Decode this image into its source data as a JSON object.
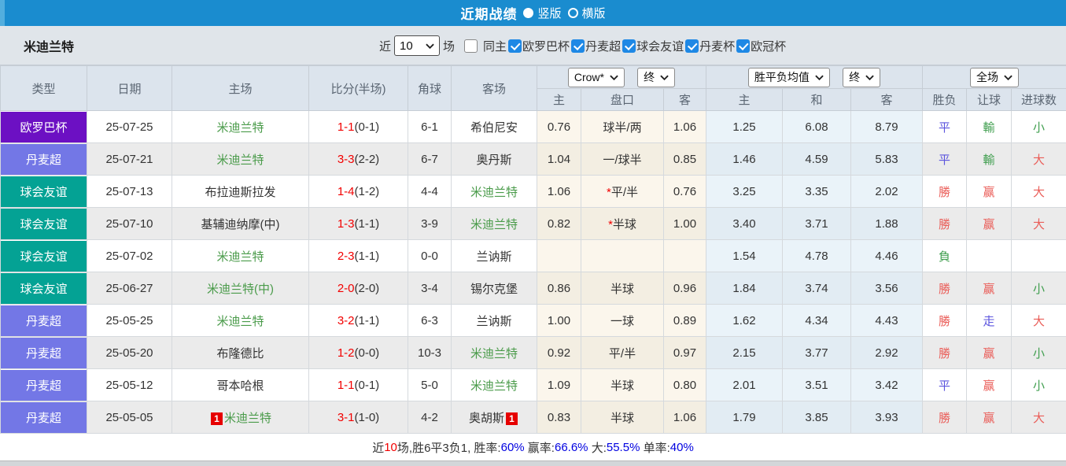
{
  "colors": {
    "titlebar_blue": "#1a8ccf",
    "checkbox_blue": "#1e88e5",
    "type_badges": {
      "europa": "#6c10c3",
      "danish_super": "#7377e6",
      "friendly": "#04a294"
    },
    "score_red": "#f20000",
    "result_red": "#ea5d58",
    "result_green": "#3f9e4e",
    "result_blue": "#5c55de",
    "team_green": "#4a9b4a",
    "stat_blue": "#0000e0"
  },
  "title_bar": {
    "title": "近期战绩",
    "options": [
      {
        "label": "竖版",
        "selected": true
      },
      {
        "label": "横版",
        "selected": false
      }
    ]
  },
  "filter_bar": {
    "team": "米迪兰特",
    "recent_prefix": "近",
    "recent_value": "10",
    "recent_suffix": "场",
    "same_home": {
      "label": "同主",
      "checked": false
    },
    "competitions": [
      {
        "label": "欧罗巴杯",
        "checked": true
      },
      {
        "label": "丹麦超",
        "checked": true
      },
      {
        "label": "球会友谊",
        "checked": true
      },
      {
        "label": "丹麦杯",
        "checked": true
      },
      {
        "label": "欧冠杯",
        "checked": true
      }
    ]
  },
  "table": {
    "left_headers": [
      "类型",
      "日期",
      "主场",
      "比分(半场)",
      "角球",
      "客场"
    ],
    "asia_selects": [
      "Crow*",
      "终"
    ],
    "euro_selects": [
      "胜平负均值",
      "终"
    ],
    "scope_select": "全场",
    "sub_headers": [
      "主",
      "盘口",
      "客",
      "主",
      "和",
      "客",
      "胜负",
      "让球",
      "进球数"
    ],
    "rows": [
      {
        "type": "欧罗巴杯",
        "type_key": "europa",
        "date": "25-07-25",
        "home": "米迪兰特",
        "home_green": true,
        "home_red_card": false,
        "score": "1-1",
        "score_half": "(0-1)",
        "corners": "6-1",
        "away": "希伯尼安",
        "away_green": false,
        "away_red_card": false,
        "asia_home": "0.76",
        "handicap": "球半/两",
        "handicap_star": false,
        "asia_away": "1.06",
        "euro_home": "1.25",
        "euro_draw": "6.08",
        "euro_away": "8.79",
        "outcome": {
          "text": "平",
          "color": "blue"
        },
        "handicap_outcome": {
          "text": "輸",
          "color": "green"
        },
        "goals_outcome": {
          "text": "小",
          "color": "green"
        }
      },
      {
        "type": "丹麦超",
        "type_key": "danish_super",
        "date": "25-07-21",
        "home": "米迪兰特",
        "home_green": true,
        "home_red_card": false,
        "score": "3-3",
        "score_half": "(2-2)",
        "corners": "6-7",
        "away": "奥丹斯",
        "away_green": false,
        "away_red_card": false,
        "asia_home": "1.04",
        "handicap": "一/球半",
        "handicap_star": false,
        "asia_away": "0.85",
        "euro_home": "1.46",
        "euro_draw": "4.59",
        "euro_away": "5.83",
        "outcome": {
          "text": "平",
          "color": "blue"
        },
        "handicap_outcome": {
          "text": "輸",
          "color": "green"
        },
        "goals_outcome": {
          "text": "大",
          "color": "red"
        }
      },
      {
        "type": "球会友谊",
        "type_key": "friendly",
        "date": "25-07-13",
        "home": "布拉迪斯拉发",
        "home_green": false,
        "home_red_card": false,
        "score": "1-4",
        "score_half": "(1-2)",
        "corners": "4-4",
        "away": "米迪兰特",
        "away_green": true,
        "away_red_card": false,
        "asia_home": "1.06",
        "handicap": "平/半",
        "handicap_star": true,
        "asia_away": "0.76",
        "euro_home": "3.25",
        "euro_draw": "3.35",
        "euro_away": "2.02",
        "outcome": {
          "text": "勝",
          "color": "red"
        },
        "handicap_outcome": {
          "text": "赢",
          "color": "red"
        },
        "goals_outcome": {
          "text": "大",
          "color": "red"
        }
      },
      {
        "type": "球会友谊",
        "type_key": "friendly",
        "date": "25-07-10",
        "home": "基辅迪纳摩(中)",
        "home_green": false,
        "home_red_card": false,
        "score": "1-3",
        "score_half": "(1-1)",
        "corners": "3-9",
        "away": "米迪兰特",
        "away_green": true,
        "away_red_card": false,
        "asia_home": "0.82",
        "handicap": "半球",
        "handicap_star": true,
        "asia_away": "1.00",
        "euro_home": "3.40",
        "euro_draw": "3.71",
        "euro_away": "1.88",
        "outcome": {
          "text": "勝",
          "color": "red"
        },
        "handicap_outcome": {
          "text": "赢",
          "color": "red"
        },
        "goals_outcome": {
          "text": "大",
          "color": "red"
        }
      },
      {
        "type": "球会友谊",
        "type_key": "friendly",
        "date": "25-07-02",
        "home": "米迪兰特",
        "home_green": true,
        "home_red_card": false,
        "score": "2-3",
        "score_half": "(1-1)",
        "corners": "0-0",
        "away": "兰讷斯",
        "away_green": false,
        "away_red_card": false,
        "asia_home": "",
        "handicap": "",
        "handicap_star": false,
        "asia_away": "",
        "euro_home": "1.54",
        "euro_draw": "4.78",
        "euro_away": "4.46",
        "outcome": {
          "text": "負",
          "color": "green"
        },
        "handicap_outcome": {
          "text": "",
          "color": "green"
        },
        "goals_outcome": {
          "text": "",
          "color": "green"
        }
      },
      {
        "type": "球会友谊",
        "type_key": "friendly",
        "date": "25-06-27",
        "home": "米迪兰特(中)",
        "home_green": true,
        "home_red_card": false,
        "score": "2-0",
        "score_half": "(2-0)",
        "corners": "3-4",
        "away": "锡尔克堡",
        "away_green": false,
        "away_red_card": false,
        "asia_home": "0.86",
        "handicap": "半球",
        "handicap_star": false,
        "asia_away": "0.96",
        "euro_home": "1.84",
        "euro_draw": "3.74",
        "euro_away": "3.56",
        "outcome": {
          "text": "勝",
          "color": "red"
        },
        "handicap_outcome": {
          "text": "赢",
          "color": "red"
        },
        "goals_outcome": {
          "text": "小",
          "color": "green"
        }
      },
      {
        "type": "丹麦超",
        "type_key": "danish_super",
        "date": "25-05-25",
        "home": "米迪兰特",
        "home_green": true,
        "home_red_card": false,
        "score": "3-2",
        "score_half": "(1-1)",
        "corners": "6-3",
        "away": "兰讷斯",
        "away_green": false,
        "away_red_card": false,
        "asia_home": "1.00",
        "handicap": "一球",
        "handicap_star": false,
        "asia_away": "0.89",
        "euro_home": "1.62",
        "euro_draw": "4.34",
        "euro_away": "4.43",
        "outcome": {
          "text": "勝",
          "color": "red"
        },
        "handicap_outcome": {
          "text": "走",
          "color": "blue"
        },
        "goals_outcome": {
          "text": "大",
          "color": "red"
        }
      },
      {
        "type": "丹麦超",
        "type_key": "danish_super",
        "date": "25-05-20",
        "home": "布隆德比",
        "home_green": false,
        "home_red_card": false,
        "score": "1-2",
        "score_half": "(0-0)",
        "corners": "10-3",
        "away": "米迪兰特",
        "away_green": true,
        "away_red_card": false,
        "asia_home": "0.92",
        "handicap": "平/半",
        "handicap_star": false,
        "asia_away": "0.97",
        "euro_home": "2.15",
        "euro_draw": "3.77",
        "euro_away": "2.92",
        "outcome": {
          "text": "勝",
          "color": "red"
        },
        "handicap_outcome": {
          "text": "赢",
          "color": "red"
        },
        "goals_outcome": {
          "text": "小",
          "color": "green"
        }
      },
      {
        "type": "丹麦超",
        "type_key": "danish_super",
        "date": "25-05-12",
        "home": "哥本哈根",
        "home_green": false,
        "home_red_card": false,
        "score": "1-1",
        "score_half": "(0-1)",
        "corners": "5-0",
        "away": "米迪兰特",
        "away_green": true,
        "away_red_card": false,
        "asia_home": "1.09",
        "handicap": "半球",
        "handicap_star": false,
        "asia_away": "0.80",
        "euro_home": "2.01",
        "euro_draw": "3.51",
        "euro_away": "3.42",
        "outcome": {
          "text": "平",
          "color": "blue"
        },
        "handicap_outcome": {
          "text": "赢",
          "color": "red"
        },
        "goals_outcome": {
          "text": "小",
          "color": "green"
        }
      },
      {
        "type": "丹麦超",
        "type_key": "danish_super",
        "date": "25-05-05",
        "home": "米迪兰特",
        "home_green": true,
        "home_red_card": true,
        "red_card_count_home": "1",
        "score": "3-1",
        "score_half": "(1-0)",
        "corners": "4-2",
        "away": "奥胡斯",
        "away_green": false,
        "away_red_card": true,
        "red_card_count_away": "1",
        "asia_home": "0.83",
        "handicap": "半球",
        "handicap_star": false,
        "asia_away": "1.06",
        "euro_home": "1.79",
        "euro_draw": "3.85",
        "euro_away": "3.93",
        "outcome": {
          "text": "勝",
          "color": "red"
        },
        "handicap_outcome": {
          "text": "赢",
          "color": "red"
        },
        "goals_outcome": {
          "text": "大",
          "color": "red"
        }
      }
    ]
  },
  "footer": {
    "segments": [
      {
        "text": "近",
        "color": "dark"
      },
      {
        "text": "10",
        "color": "red"
      },
      {
        "text": "场,胜6平3负1, 胜率:",
        "color": "dark"
      },
      {
        "text": "60%",
        "color": "blue"
      },
      {
        "text": " 赢率:",
        "color": "dark"
      },
      {
        "text": "66.6%",
        "color": "blue"
      },
      {
        "text": " 大:",
        "color": "dark"
      },
      {
        "text": "55.5%",
        "color": "blue"
      },
      {
        "text": " 单率:",
        "color": "dark"
      },
      {
        "text": "40%",
        "color": "blue"
      }
    ]
  }
}
